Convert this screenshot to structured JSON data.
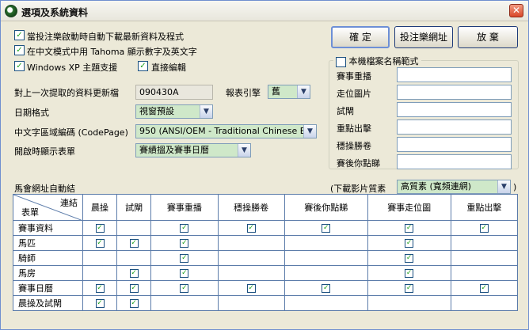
{
  "window": {
    "title": "選項及系統資料",
    "close_glyph": "✕"
  },
  "options": {
    "auto_download": {
      "label": "當投注樂啟動時自動下載最新資料及程式",
      "checked": true
    },
    "tahoma": {
      "label": "在中文模式中用 Tahoma 顯示數字及英文字",
      "checked": true
    },
    "xp_theme": {
      "label": "Windows XP 主題支援",
      "checked": true
    },
    "direct_edit": {
      "label": "直接編輯",
      "checked": true
    }
  },
  "fields": {
    "last_update": {
      "label": "對上一次提取的資料更新檔",
      "value": "090430A"
    },
    "report_engine": {
      "label": "報表引擎",
      "value": "舊"
    },
    "date_format": {
      "label": "日期格式",
      "value": "視窗預設"
    },
    "codepage": {
      "label": "中文字區域編碼 (CodePage)",
      "value": "950 (ANSI/OEM - Traditional Chinese Big5)"
    },
    "startup_table": {
      "label": "開啟時顯示表單",
      "value": "賽績搵及賽事日曆"
    }
  },
  "buttons": {
    "ok": "確 定",
    "betting_url": "投注樂網址",
    "cancel": "放 棄"
  },
  "filename_group": {
    "label": "本機檔案名稱範式",
    "checked": false,
    "rows": [
      {
        "label": "賽事重播",
        "value": ""
      },
      {
        "label": "走位圖片",
        "value": ""
      },
      {
        "label": "試閘",
        "value": ""
      },
      {
        "label": "重點出擊",
        "value": ""
      },
      {
        "label": "穩操勝卷",
        "value": ""
      },
      {
        "label": "賽後你點睇",
        "value": ""
      }
    ]
  },
  "grid_section": {
    "label": "馬會網址自動結",
    "video_quality_label": "(下載影片質素",
    "video_quality_value": "高質素 (寬頻連網)",
    "video_quality_close": ")"
  },
  "grid": {
    "corner_top": "連結",
    "corner_bottom": "表單",
    "columns": [
      "晨操",
      "試閘",
      "賽事重播",
      "穩操勝卷",
      "賽後你點睇",
      "賽事走位圖",
      "重點出擊"
    ],
    "rows": [
      {
        "label": "賽事資料",
        "checks": [
          true,
          false,
          true,
          true,
          true,
          true,
          true
        ]
      },
      {
        "label": "馬匹",
        "checks": [
          true,
          true,
          true,
          false,
          false,
          true,
          false
        ]
      },
      {
        "label": "騎師",
        "checks": [
          false,
          false,
          true,
          false,
          false,
          true,
          false
        ]
      },
      {
        "label": "馬房",
        "checks": [
          false,
          true,
          true,
          false,
          false,
          true,
          false
        ]
      },
      {
        "label": "賽事日曆",
        "checks": [
          true,
          true,
          true,
          true,
          true,
          true,
          true
        ]
      },
      {
        "label": "晨操及試閘",
        "checks": [
          true,
          true,
          false,
          false,
          false,
          false,
          false
        ]
      }
    ]
  },
  "colors": {
    "window_bg": "#ece9d8",
    "combo_bg": "#cfe8c9",
    "grid_border": "#5c7caa",
    "check_mark": "#21a121"
  },
  "icons": {
    "app": "app-horse-icon",
    "close": "close-icon",
    "dropdown": "chevron-down-icon"
  }
}
